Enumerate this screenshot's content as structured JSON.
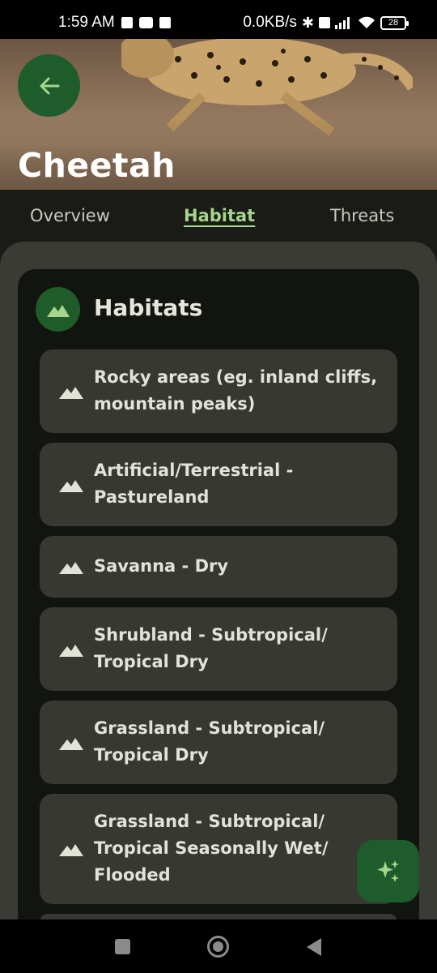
{
  "status_bar": {
    "time": "1:59 AM",
    "network_speed": "0.0KB/s",
    "battery": "28",
    "icons": [
      "twitch-icon",
      "youtube-icon",
      "mail-icon",
      "bluetooth-icon",
      "volte-icon",
      "signal-icon",
      "wifi-icon",
      "battery-icon"
    ]
  },
  "header": {
    "title": "Cheetah",
    "back_icon": "arrow-left-icon"
  },
  "tabs": [
    {
      "label": "Overview",
      "active": false
    },
    {
      "label": "Habitat",
      "active": true
    },
    {
      "label": "Threats",
      "active": false
    }
  ],
  "habitats_card": {
    "title": "Habitats",
    "icon": "mountain-icon",
    "items": [
      {
        "label": "Rocky areas (eg. inland cliffs, mountain peaks)"
      },
      {
        "label": "Artificial/Terrestrial - Pastureland"
      },
      {
        "label": "Savanna - Dry"
      },
      {
        "label": "Shrubland - Subtropical/ Tropical Dry"
      },
      {
        "label": "Grassland - Subtropical/ Tropical Dry"
      },
      {
        "label": "Grassland - Subtropical/ Tropical Seasonally Wet/ Flooded"
      }
    ]
  },
  "fab": {
    "icon": "sparkle-icon"
  },
  "colors": {
    "accent_green": "#1e5c2b",
    "active_tab": "#a6d58c",
    "card_bg": "#121410",
    "item_bg": "#363831"
  }
}
